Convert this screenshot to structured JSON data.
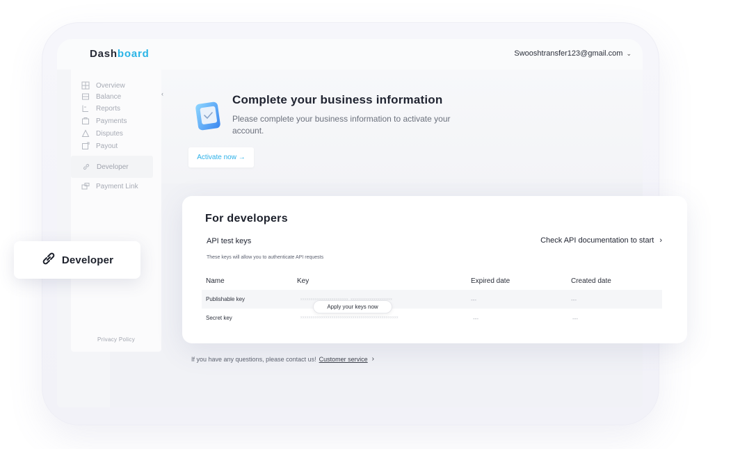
{
  "header": {
    "logo_main": "Dash",
    "logo_accent": "board",
    "account_email": "Swooshtransfer123@gmail.com"
  },
  "sidebar": {
    "items": [
      {
        "label": "Overview",
        "icon": "grid-icon"
      },
      {
        "label": "Balance",
        "icon": "wallet-icon"
      },
      {
        "label": "Reports",
        "icon": "reports-icon"
      },
      {
        "label": "Payments",
        "icon": "payments-icon"
      },
      {
        "label": "Disputes",
        "icon": "disputes-icon"
      },
      {
        "label": "Payout",
        "icon": "payout-icon"
      },
      {
        "label": "Developer",
        "icon": "link-icon"
      },
      {
        "label": "Payment Link",
        "icon": "payment-link-icon"
      }
    ],
    "active": "Developer",
    "privacy_label": "Privacy Policy"
  },
  "banner": {
    "title": "Complete your business information",
    "description": "Please complete your business information to activate your account.",
    "activate_label": "Activate now →"
  },
  "developers": {
    "title": "For developers",
    "keys_label": "API test keys",
    "docs_link": "Check API documentation to start",
    "hint": "These keys will allow you to authenticate API requests",
    "columns": [
      "Name",
      "Key",
      "Expired date",
      "Created date"
    ],
    "rows": [
      {
        "name": "Publishable key",
        "key": "xxxxxxxxxxxxxxxxxxxxxxx_xxxxxxxxxxxxxxxxxxxx",
        "expired": "---",
        "created": "---"
      },
      {
        "name": "Secret key",
        "key": "xxxxxxxxxxxxxxxxxxxxxxxxxxxxxxxxxxxxxxxxxxxxxxx",
        "expired": "---",
        "created": "---"
      }
    ],
    "apply_label": "Apply your keys now"
  },
  "floating_badge": {
    "label": "Developer",
    "icon": "link-icon"
  },
  "contact": {
    "text": "If you have any questions, please contact us!",
    "link": "Customer service"
  },
  "colors": {
    "accent": "#2ab4e6",
    "text_dark": "#1f2330",
    "muted": "#a6aab4"
  }
}
